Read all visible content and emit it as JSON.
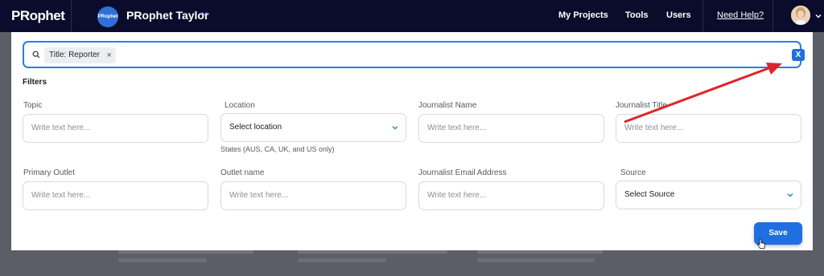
{
  "app": {
    "logo": "PRophet",
    "workspace_badge": "PRophet",
    "workspace_name": "PRophet Taylor",
    "nav": [
      "My Projects",
      "Tools",
      "Users"
    ],
    "help": "Need Help?"
  },
  "search": {
    "chip_label": "Title: Reporter",
    "chip_remove": "×",
    "clear_label": "X"
  },
  "filters": {
    "title": "Filters",
    "fields": [
      {
        "label": "Topic",
        "value": "Write text here...",
        "kind": "text"
      },
      {
        "label": "Location",
        "value": "Select location",
        "kind": "select",
        "hint": "States (AUS, CA, UK, and US only)"
      },
      {
        "label": "Journalist Name",
        "value": "Write text here...",
        "kind": "text"
      },
      {
        "label": "Journalist Title",
        "value": "Write text here...",
        "kind": "text"
      },
      {
        "label": "Primary Outlet",
        "value": "Write text here...",
        "kind": "text"
      },
      {
        "label": "Outlet name",
        "value": "Write text here...",
        "kind": "text"
      },
      {
        "label": "Journalist Email Address",
        "value": "Write text here...",
        "kind": "text"
      },
      {
        "label": "Source",
        "value": "Select Source",
        "kind": "select"
      }
    ]
  },
  "save_label": "Save",
  "colors": {
    "nav_bg": "#0b0c2b",
    "accent": "#1f6fe0",
    "annotation_arrow": "#e0242a"
  }
}
